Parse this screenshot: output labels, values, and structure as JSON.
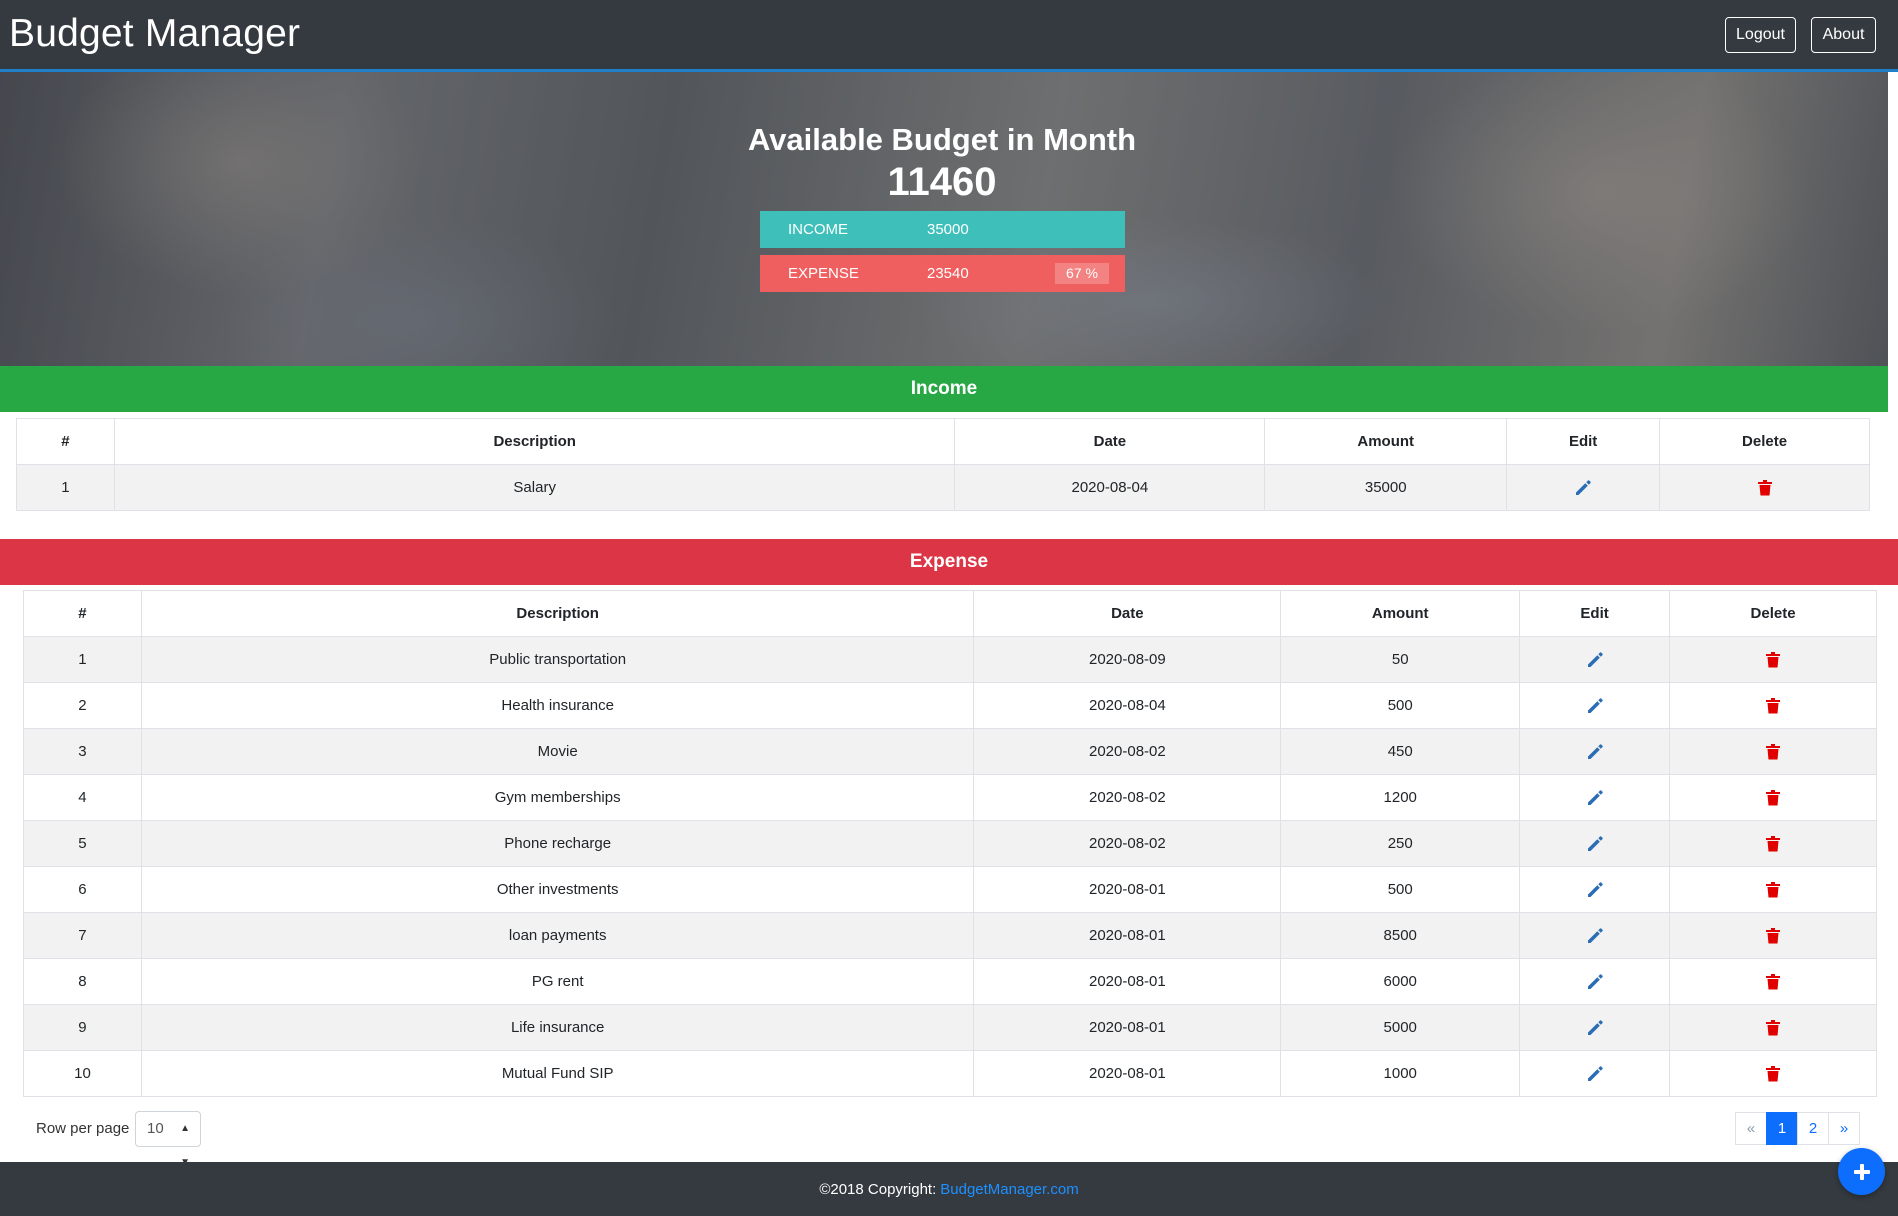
{
  "navbar": {
    "brand": "Budget Manager",
    "logout_label": "Logout",
    "about_label": "About"
  },
  "hero": {
    "title": "Available Budget in Month",
    "available": "11460",
    "income_label": "INCOME",
    "income_value": "35000",
    "expense_label": "EXPENSE",
    "expense_value": "23540",
    "expense_percent": "67 %"
  },
  "income": {
    "heading": "Income",
    "columns": [
      "#",
      "Description",
      "Date",
      "Amount",
      "Edit",
      "Delete"
    ],
    "rows": [
      {
        "no": "1",
        "description": "Salary",
        "date": "2020-08-04",
        "amount": "35000"
      }
    ]
  },
  "expense": {
    "heading": "Expense",
    "columns": [
      "#",
      "Description",
      "Date",
      "Amount",
      "Edit",
      "Delete"
    ],
    "rows": [
      {
        "no": "1",
        "description": "Public transportation",
        "date": "2020-08-09",
        "amount": "50"
      },
      {
        "no": "2",
        "description": "Health insurance",
        "date": "2020-08-04",
        "amount": "500"
      },
      {
        "no": "3",
        "description": "Movie",
        "date": "2020-08-02",
        "amount": "450"
      },
      {
        "no": "4",
        "description": "Gym memberships",
        "date": "2020-08-02",
        "amount": "1200"
      },
      {
        "no": "5",
        "description": "Phone recharge",
        "date": "2020-08-02",
        "amount": "250"
      },
      {
        "no": "6",
        "description": "Other investments",
        "date": "2020-08-01",
        "amount": "500"
      },
      {
        "no": "7",
        "description": "loan payments",
        "date": "2020-08-01",
        "amount": "8500"
      },
      {
        "no": "8",
        "description": "PG rent",
        "date": "2020-08-01",
        "amount": "6000"
      },
      {
        "no": "9",
        "description": "Life insurance",
        "date": "2020-08-01",
        "amount": "5000"
      },
      {
        "no": "10",
        "description": "Mutual Fund SIP",
        "date": "2020-08-01",
        "amount": "1000"
      }
    ]
  },
  "pagination": {
    "rows_label": "Row per page",
    "rows_value": "10",
    "prev": "«",
    "pages": [
      "1",
      "2"
    ],
    "next": "»",
    "current_page": "1"
  },
  "footer": {
    "copyright": "©2018 Copyright:",
    "link_text": "BudgetManager.com"
  },
  "icons": {
    "edit": "pencil-icon",
    "delete": "trash-icon",
    "fab": "plus-icon"
  },
  "colors": {
    "navbar": "#343a40",
    "income_bar": "#3ebfb9",
    "expense_bar": "#f05f5f",
    "income_header": "#28a745",
    "expense_header": "#dc3545",
    "edit_icon": "#2a6db4",
    "delete_icon": "#e00000",
    "primary": "#0d6efd"
  }
}
